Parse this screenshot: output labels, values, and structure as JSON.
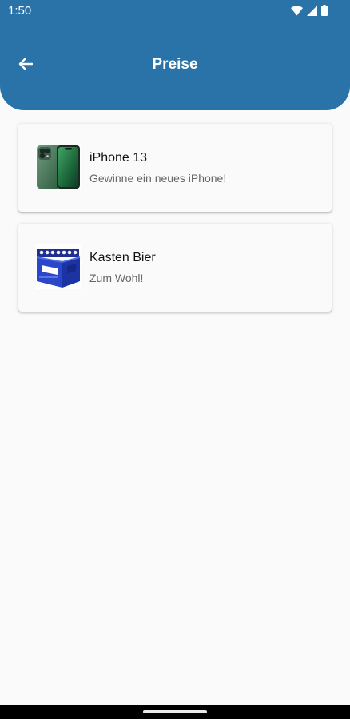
{
  "status_bar": {
    "time": "1:50",
    "icons": [
      "wifi-icon",
      "signal-icon",
      "battery-icon"
    ]
  },
  "app_bar": {
    "title": "Preise",
    "back_icon": "arrow-left-icon"
  },
  "prizes": [
    {
      "title": "iPhone 13",
      "subtitle": "Gewinne ein neues iPhone!",
      "image": "iphone-image"
    },
    {
      "title": "Kasten Bier",
      "subtitle": "Zum Wohl!",
      "image": "beer-crate-image"
    }
  ],
  "colors": {
    "primary": "#2a73a8",
    "background": "#fafafa",
    "card": "#fafafa",
    "title_text": "#111111",
    "subtitle_text": "#666666"
  }
}
